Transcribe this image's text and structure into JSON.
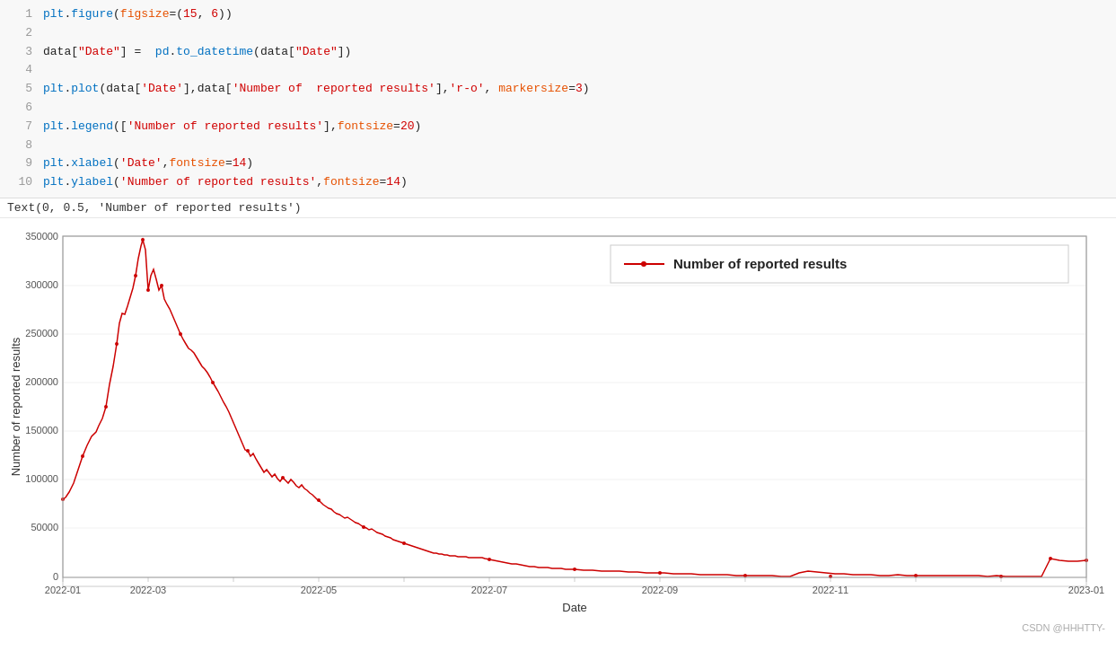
{
  "code": {
    "lines": [
      {
        "num": 1,
        "content": "plt.figure(figsize=(15, 6))"
      },
      {
        "num": 2,
        "content": ""
      },
      {
        "num": 3,
        "content": "data[\"Date\"] =  pd.to_datetime(data[\"Date\"])"
      },
      {
        "num": 4,
        "content": ""
      },
      {
        "num": 5,
        "content": "plt.plot(data['Date'],data['Number of  reported results'],'r-o', markersize=3)"
      },
      {
        "num": 6,
        "content": ""
      },
      {
        "num": 7,
        "content": "plt.legend(['Number of reported results'],fontsize=20)"
      },
      {
        "num": 8,
        "content": ""
      },
      {
        "num": 9,
        "content": "plt.xlabel('Date',fontsize=14)"
      },
      {
        "num": 10,
        "content": "plt.ylabel('Number of reported results',fontsize=14)"
      }
    ]
  },
  "output_text": "Text(0, 0.5, 'Number of reported results')",
  "chart": {
    "title": "Number of reported results",
    "x_label": "Date",
    "y_label": "Number of reported results",
    "legend_label": "Number of reported results",
    "watermark": "CSDN @HHHTTY-"
  }
}
